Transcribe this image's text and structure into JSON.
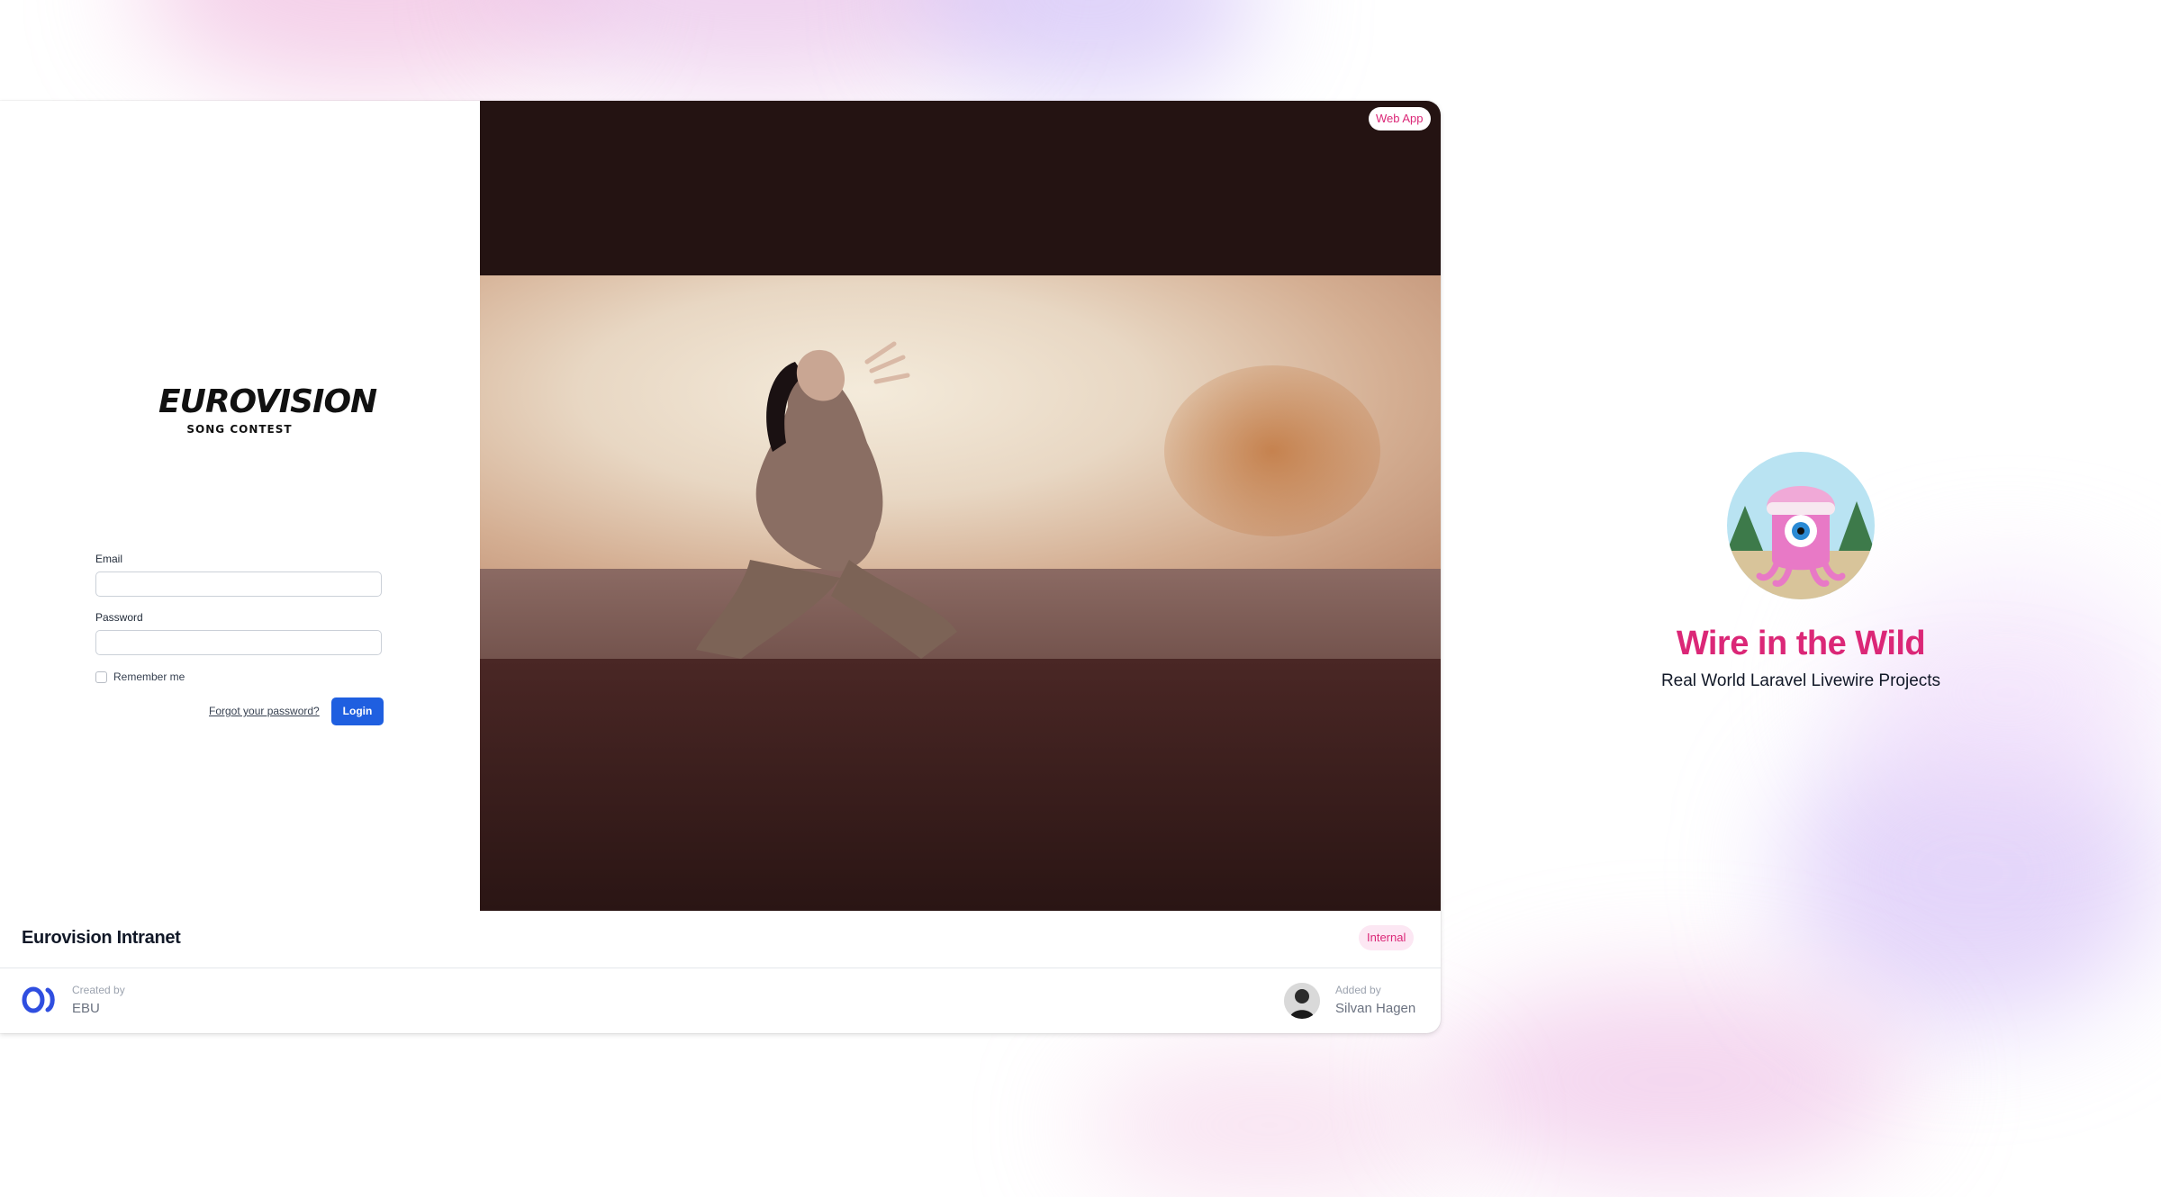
{
  "login": {
    "logo_word": "EUROVISION",
    "logo_sub": "SONG CONTEST",
    "email_label": "Email",
    "password_label": "Password",
    "remember_label": "Remember me",
    "forgot_label": "Forgot your password?",
    "login_button": "Login"
  },
  "card": {
    "type_badge": "Web App",
    "title": "Eurovision Intranet",
    "status_badge": "Internal",
    "created_by_caption": "Created by",
    "created_by_value": "EBU",
    "added_by_caption": "Added by",
    "added_by_value": "Silvan Hagen"
  },
  "hero": {
    "title": "Wire in the Wild",
    "subtitle": "Real World Laravel Livewire Projects"
  },
  "colors": {
    "accent_pink": "#db2777",
    "badge_pink_bg": "#fce7f3",
    "login_blue": "#1f5fe0"
  }
}
